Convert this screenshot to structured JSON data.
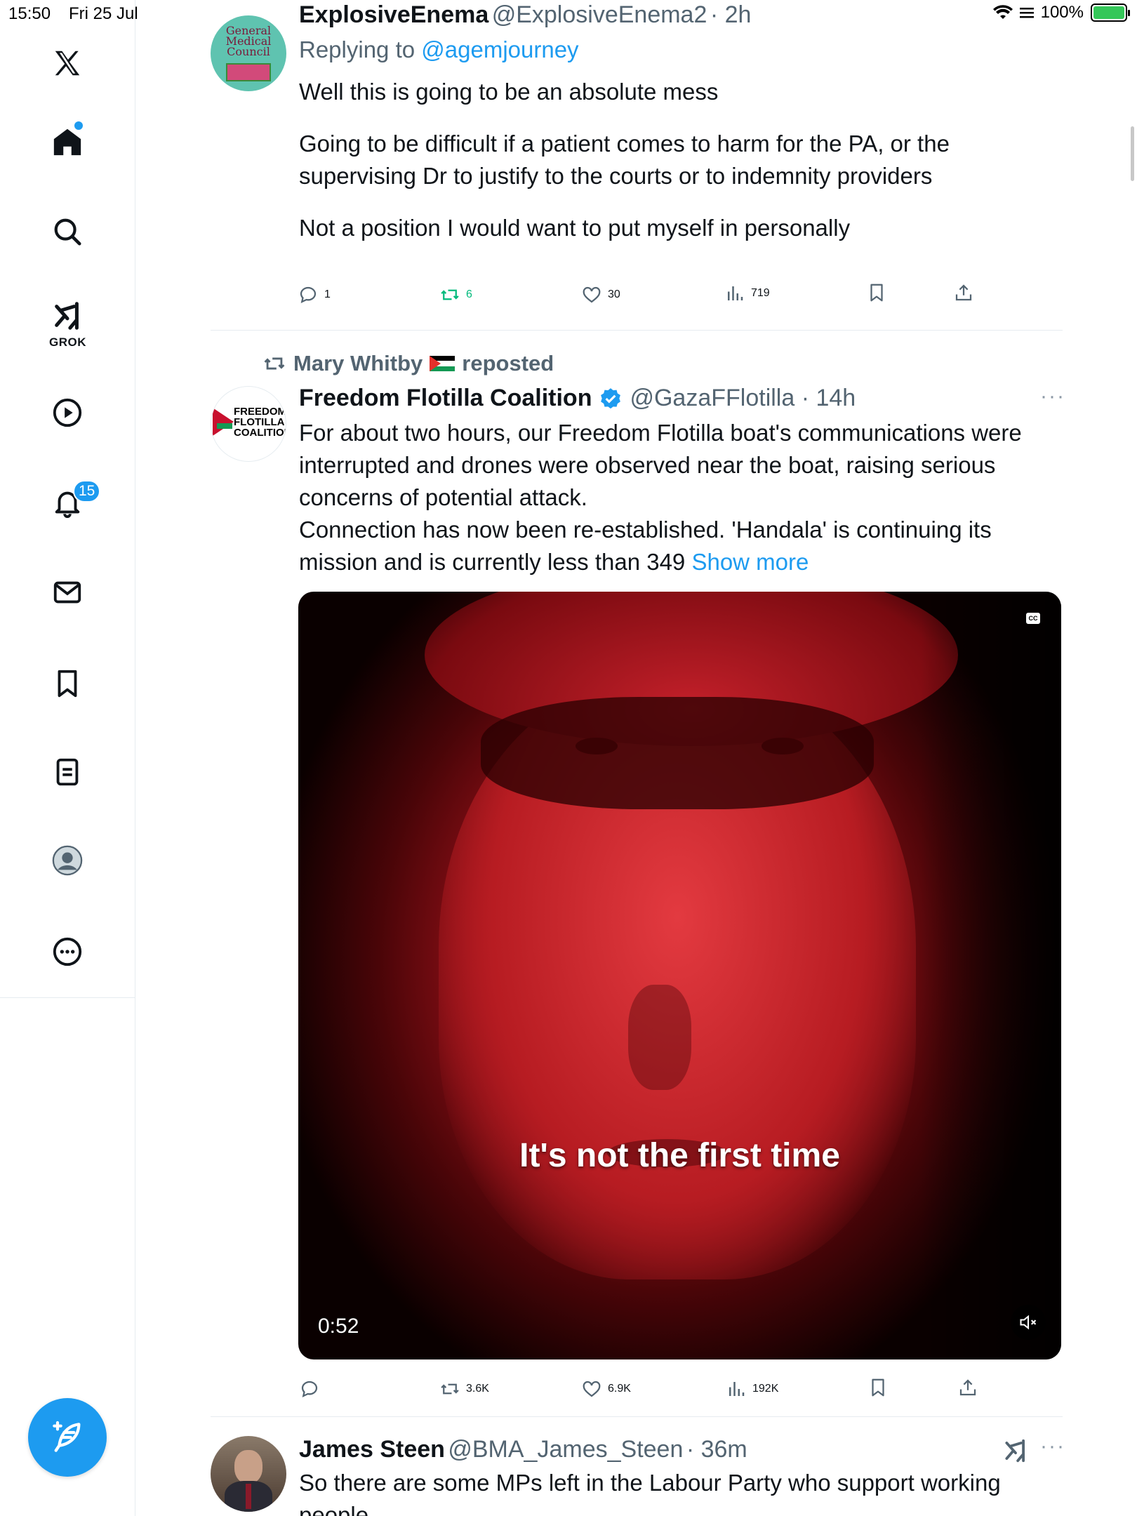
{
  "status_bar": {
    "time": "15:50",
    "date": "Fri 25 Jul",
    "battery": "100%"
  },
  "sidebar": {
    "grok_label": "GROK",
    "notifications_count": "15",
    "items": [
      "x-logo",
      "home",
      "search",
      "grok",
      "video",
      "notifications",
      "messages",
      "bookmarks",
      "lists",
      "profile",
      "more"
    ]
  },
  "tweets": [
    {
      "name": "ExplosiveEnema",
      "handle": "@ExplosiveEnema2",
      "time": "2h",
      "replying_prefix": "Replying to ",
      "replying_to": "@agemjourney",
      "avatar_text": "General Medical Council",
      "paragraphs": [
        "Well this is going to be an absolute mess",
        "Going to be difficult if a patient comes to harm for the PA, or the supervising Dr to justify to the courts or to indemnity providers",
        "Not a position I would want to put myself in personally"
      ],
      "stats": {
        "replies": "1",
        "reposts": "6",
        "likes": "30",
        "views": "719"
      }
    },
    {
      "repost_by": "Mary Whitby",
      "repost_suffix": "reposted",
      "name": "Freedom Flotilla Coalition",
      "handle": "@GazaFFlotilla",
      "time": "14h",
      "avatar_text": "FREEDOM FLOTILLA COALITION",
      "text": "For about two hours, our Freedom Flotilla boat's communications were interrupted and drones were observed near the boat, raising serious concerns of potential attack.",
      "text2": "Connection has now been re-established. 'Handala' is continuing its mission and is currently less than 349",
      "show_more": "Show more",
      "video": {
        "caption": "It's not the first time",
        "duration": "0:52",
        "cc": "CC"
      },
      "stats": {
        "replies": "",
        "reposts": "3.6K",
        "likes": "6.9K",
        "views": "192K"
      }
    },
    {
      "name": "James Steen",
      "handle": "@BMA_James_Steen",
      "time": "36m",
      "text": "So there are some MPs left in the Labour Party who support working people"
    }
  ],
  "colors": {
    "accent": "#1d9bf0",
    "repost_green": "#00ba7c",
    "muted": "#536471"
  }
}
